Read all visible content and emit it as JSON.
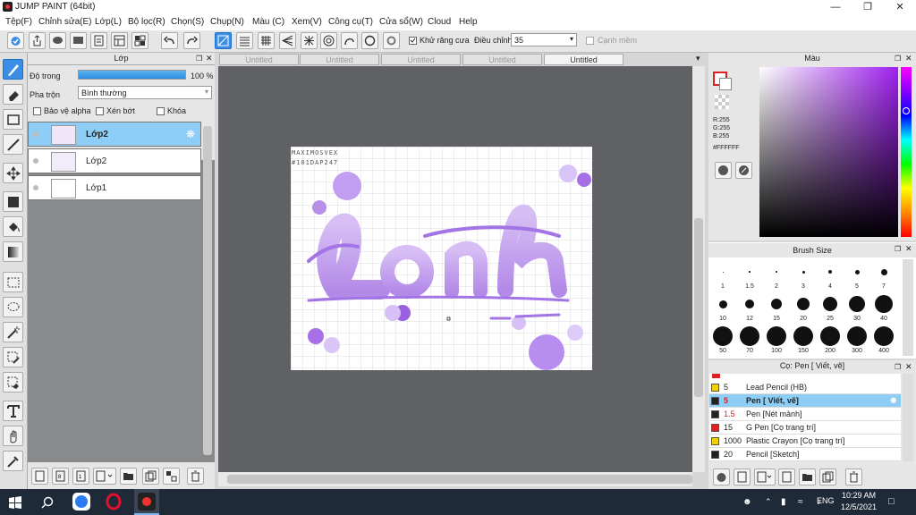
{
  "window": {
    "title": "JUMP PAINT (64bit)"
  },
  "menu": [
    "Tệp(F)",
    "Chỉnh sửa(E)",
    "Lớp(L)",
    "Bộ lọc(R)",
    "Chọn(S)",
    "Chụp(N)",
    "Màu (C)",
    "Xem(V)",
    "Công cụ(T)",
    "Cửa sổ(W)",
    "Cloud",
    "Help"
  ],
  "toolbar": {
    "antialias_label": "Khử răng cưa",
    "adjust_label": "Điều chỉnh",
    "adjust_value": "35",
    "smooth_label": "Cạnh mềm"
  },
  "layer_panel": {
    "title": "Lớp",
    "opacity_label": "Độ trong",
    "opacity_value": "100 %",
    "opacity_fraction": 1.0,
    "blend_label": "Pha trộn",
    "blend_value": "Bình thường",
    "protect_alpha": "Bảo vệ alpha",
    "clip": "Xén bớt",
    "lock": "Khóa",
    "layers": [
      {
        "name": "Lớp2"
      },
      {
        "name": "Lớp2"
      },
      {
        "name": "Lớp1"
      }
    ]
  },
  "tabs": [
    "Untitled",
    "Untitled",
    "Untitled",
    "Untitled",
    "Untitled"
  ],
  "canvas": {
    "watermark_line1": "MAXIMOSVEX",
    "watermark_line2": "#101DAP247",
    "art_text": "Lanh"
  },
  "color_panel": {
    "title": "Màu",
    "r": "R:255",
    "g": "G:255",
    "b": "B:255",
    "hex": "#FFFFFF",
    "fg_color": "#e02020"
  },
  "brush_size_panel": {
    "title": "Brush Size",
    "sizes": [
      "1",
      "1.5",
      "2",
      "3",
      "4",
      "5",
      "7",
      "10",
      "12",
      "15",
      "20",
      "25",
      "30",
      "40",
      "50",
      "70",
      "100",
      "150",
      "200",
      "300",
      "400"
    ]
  },
  "brush_panel": {
    "title": "Cọ: Pen [ Viết, vẽ]",
    "items": [
      {
        "size": "5",
        "name": "Lead Pencil (HB)",
        "color": "#f0d000"
      },
      {
        "size": "5",
        "name": "Pen [ Viết, vẽ]",
        "color": "#222222"
      },
      {
        "size": "1.5",
        "name": "Pen [Nét mảnh]",
        "color": "#222222"
      },
      {
        "size": "15",
        "name": "G Pen [Cọ trang trí]",
        "color": "#e02020"
      },
      {
        "size": "1000",
        "name": "Plastic Crayon [Cọ trang trí]",
        "color": "#f0d000"
      },
      {
        "size": "20",
        "name": "Pencil [Sketch]",
        "color": "#222222"
      }
    ]
  },
  "taskbar": {
    "lang": "ENG",
    "time": "10:29 AM",
    "date": "12/5/2021"
  }
}
